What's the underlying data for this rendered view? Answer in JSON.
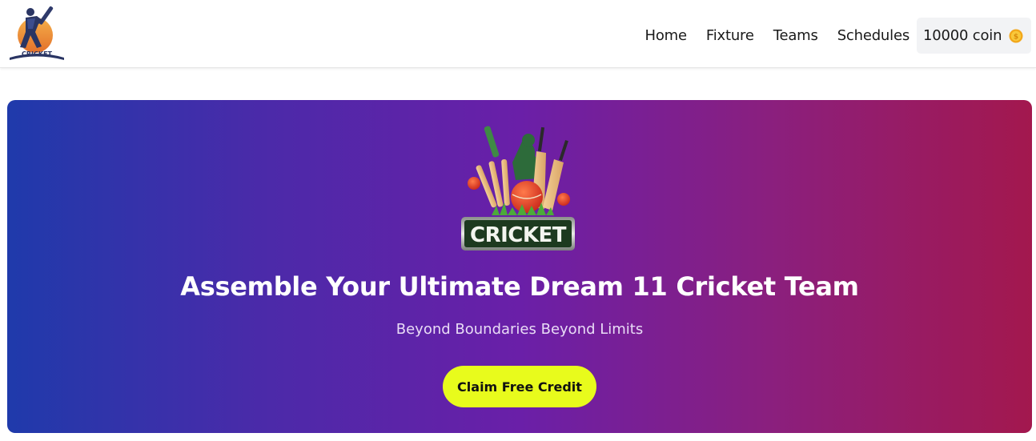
{
  "brand": {
    "logo_text": "CRICKET",
    "logo_icon": "cricket-batsman-logo"
  },
  "nav": {
    "items": [
      "Home",
      "Fixture",
      "Teams",
      "Schedules"
    ],
    "coin_label": "10000 coin",
    "coin_icon": "gold-coin-icon"
  },
  "hero": {
    "graphic_text": "CRICKET",
    "graphic_icon": "cricket-bats-stumps-ball-illustration",
    "title": "Assemble Your Ultimate Dream 11 Cricket Team",
    "subtitle": "Beyond Boundaries Beyond Limits",
    "cta_label": "Claim Free Credit"
  },
  "colors": {
    "gradient_start": "#1f3aab",
    "gradient_mid": "#6a1fa8",
    "gradient_end": "#a3184e",
    "cta_background": "#e8fb1c",
    "nav_coin_background": "#f2f3f5"
  }
}
